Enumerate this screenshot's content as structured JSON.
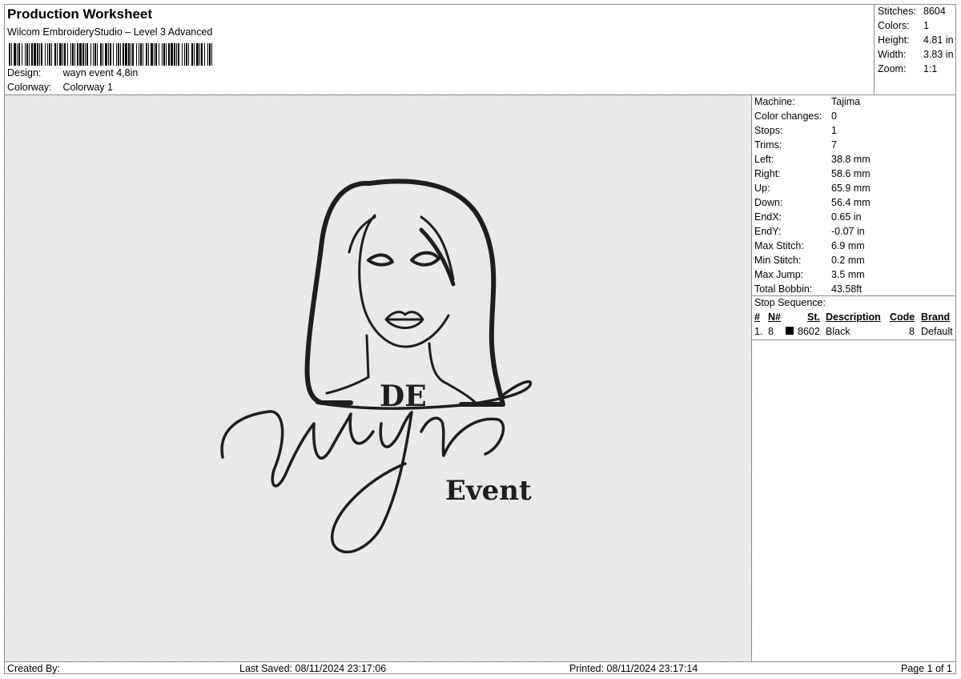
{
  "header": {
    "title": "Production Worksheet",
    "subtitle": "Wilcom EmbroideryStudio – Level 3 Advanced",
    "design_label": "Design:",
    "design_value": "wayn event 4,8in",
    "colorway_label": "Colorway:",
    "colorway_value": "Colorway 1"
  },
  "summary": {
    "stitches_label": "Stitches:",
    "stitches_value": "8604",
    "colors_label": "Colors:",
    "colors_value": "1",
    "height_label": "Height:",
    "height_value": "4.81 in",
    "width_label": "Width:",
    "width_value": "3.83 in",
    "zoom_label": "Zoom:",
    "zoom_value": "1:1"
  },
  "machine_info": [
    {
      "label": "Machine:",
      "value": "Tajima"
    },
    {
      "label": "Color changes:",
      "value": "0"
    },
    {
      "label": "Stops:",
      "value": "1"
    },
    {
      "label": "Trims:",
      "value": "7"
    },
    {
      "label": "Left:",
      "value": "38.8 mm"
    },
    {
      "label": "Right:",
      "value": "58.6 mm"
    },
    {
      "label": "Up:",
      "value": "65.9 mm"
    },
    {
      "label": "Down:",
      "value": "56.4 mm"
    },
    {
      "label": "EndX:",
      "value": "0.65 in"
    },
    {
      "label": "EndY:",
      "value": "-0.07 in"
    },
    {
      "label": "Max Stitch:",
      "value": "6.9 mm"
    },
    {
      "label": "Min Stitch:",
      "value": "0.2 mm"
    },
    {
      "label": "Max Jump:",
      "value": "3.5 mm"
    },
    {
      "label": "Total Bobbin:",
      "value": "43.58ft"
    }
  ],
  "stop_sequence": {
    "title": "Stop Sequence:",
    "headers": {
      "num": "#",
      "n": "N#",
      "st": "St.",
      "description": "Description",
      "code": "Code",
      "brand": "Brand"
    },
    "rows": [
      {
        "num": "1.",
        "n": "8",
        "st": "8602",
        "description": "Black",
        "code": "8",
        "brand": "Default",
        "color": "#000000"
      }
    ]
  },
  "design_artwork": {
    "text_top": "DE",
    "text_script": "Wayn",
    "text_bottom": "Event",
    "thread_color": "#1e1e1e",
    "fabric_color": "#e6e6e6"
  },
  "footer": {
    "created_by": "Created By:",
    "last_saved": "Last Saved: 08/11/2024 23:17:06",
    "printed": "Printed: 08/11/2024 23:17:14",
    "page": "Page 1 of 1"
  }
}
